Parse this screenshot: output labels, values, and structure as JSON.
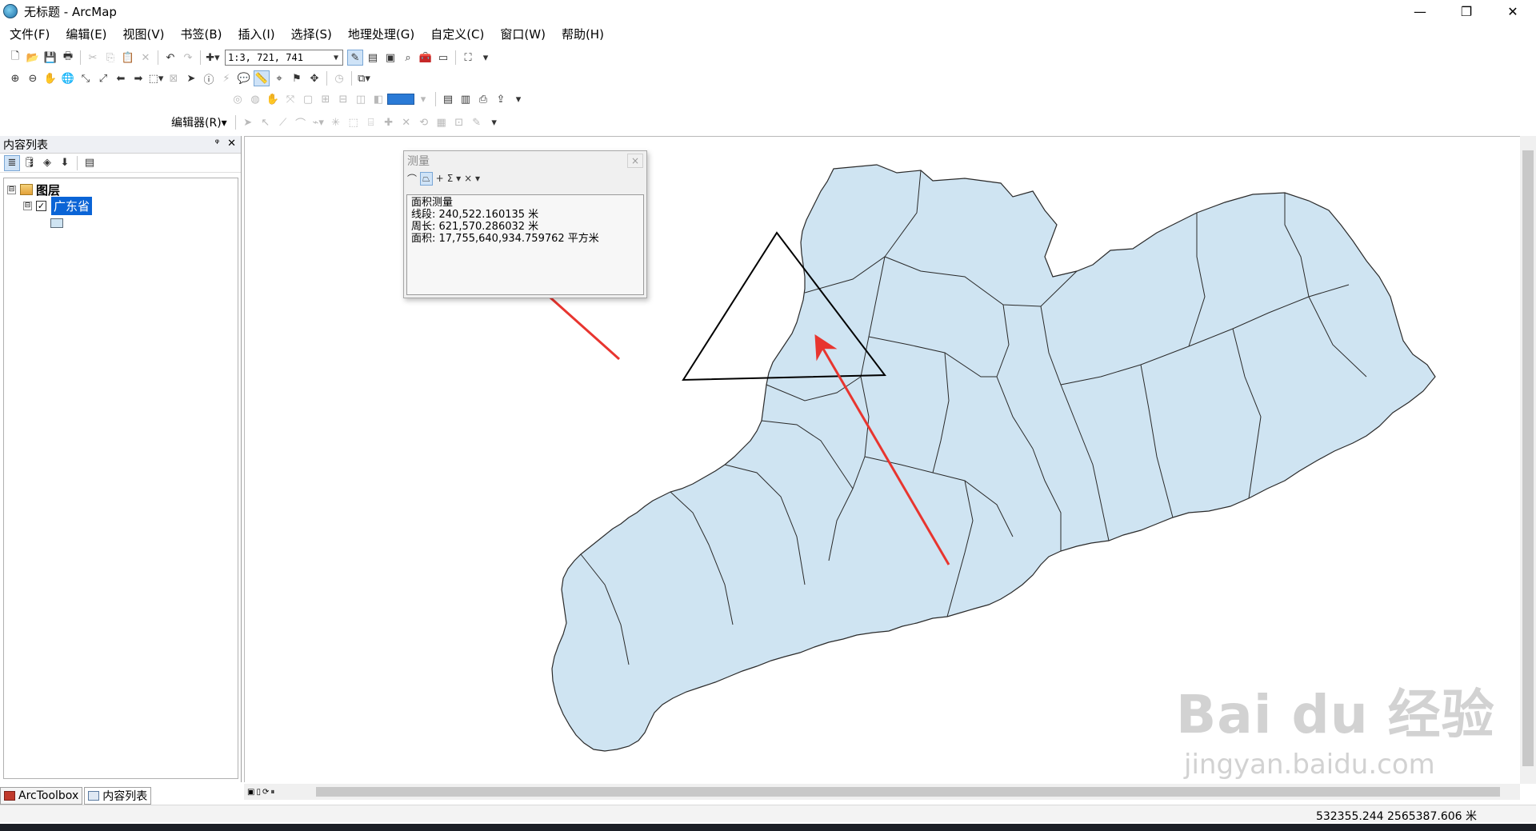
{
  "window": {
    "title": "无标题 - ArcMap",
    "minimize": "—",
    "restore": "❐",
    "close": "✕"
  },
  "menu": [
    "文件(F)",
    "编辑(E)",
    "视图(V)",
    "书签(B)",
    "插入(I)",
    "选择(S)",
    "地理处理(G)",
    "自定义(C)",
    "窗口(W)",
    "帮助(H)"
  ],
  "toolbar": {
    "scale": "1:3, 721, 741",
    "editor_label": "编辑器(R)▾"
  },
  "toc": {
    "title": "内容列表",
    "pin": "ᵠ",
    "close": "✕",
    "root_label": "图层",
    "layer_name": "广东省",
    "expander_open": "⊟",
    "checked": "✓"
  },
  "bottom_tabs": {
    "arctoolbox": "ArcToolbox",
    "toc": "内容列表"
  },
  "measure": {
    "title": "测量",
    "close": "×",
    "tools": [
      "⌒",
      "⏢",
      "+",
      "Σ ▾",
      "× ▾"
    ],
    "lines": [
      "面积测量",
      "线段: 240,522.160135 米",
      "周长: 621,570.286032 米",
      "面积: 17,755,640,934.759762 平方米"
    ]
  },
  "status": {
    "coords": "532355.244  2565387.606 米"
  },
  "watermark": {
    "main": "Bai du 经验",
    "sub": "jingyan.baidu.com"
  },
  "map": {
    "fill": "#cfe4f2",
    "stroke": "#2a2a2a",
    "triangle": "#000000",
    "arrow": "#e8352f"
  }
}
